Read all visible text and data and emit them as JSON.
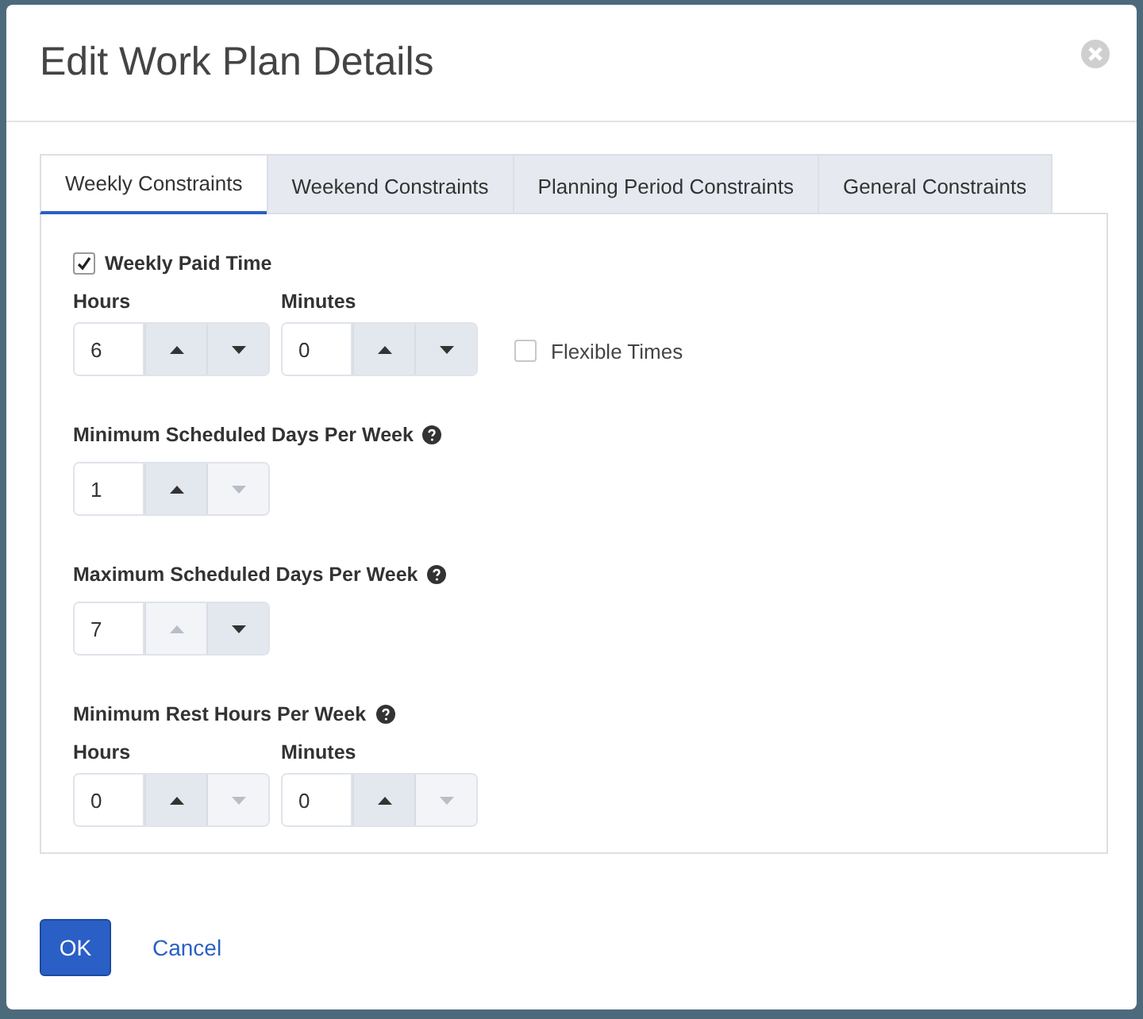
{
  "dialog": {
    "title": "Edit Work Plan Details"
  },
  "tabs": [
    {
      "label": "Weekly Constraints",
      "selected": true
    },
    {
      "label": "Weekend Constraints",
      "selected": false
    },
    {
      "label": "Planning Period Constraints",
      "selected": false
    },
    {
      "label": "General Constraints",
      "selected": false
    }
  ],
  "sections": [
    {
      "kind": "checkbox",
      "label": "Weekly Paid Time",
      "checked": true,
      "spinners": [
        {
          "label": "Hours",
          "value": "6",
          "up_disabled": false,
          "down_disabled": false
        },
        {
          "label": "Minutes",
          "value": "0",
          "up_disabled": false,
          "down_disabled": false
        }
      ],
      "option": {
        "label": "Flexible Times",
        "checked": false
      }
    },
    {
      "kind": "heading",
      "label": "Minimum Scheduled Days Per Week",
      "help": true,
      "spinners": [
        {
          "value": "1",
          "up_disabled": false,
          "down_disabled": true
        }
      ]
    },
    {
      "kind": "heading",
      "label": "Maximum Scheduled Days Per Week",
      "help": true,
      "spinners": [
        {
          "value": "7",
          "up_disabled": true,
          "down_disabled": false
        }
      ]
    },
    {
      "kind": "heading",
      "label": "Minimum Rest Hours Per Week",
      "help": true,
      "spinners": [
        {
          "label": "Hours",
          "value": "0",
          "up_disabled": false,
          "down_disabled": true
        },
        {
          "label": "Minutes",
          "value": "0",
          "up_disabled": false,
          "down_disabled": true
        }
      ]
    }
  ],
  "buttons": [
    {
      "label": "OK",
      "kind": "primary"
    },
    {
      "label": "Cancel",
      "kind": "link"
    }
  ]
}
